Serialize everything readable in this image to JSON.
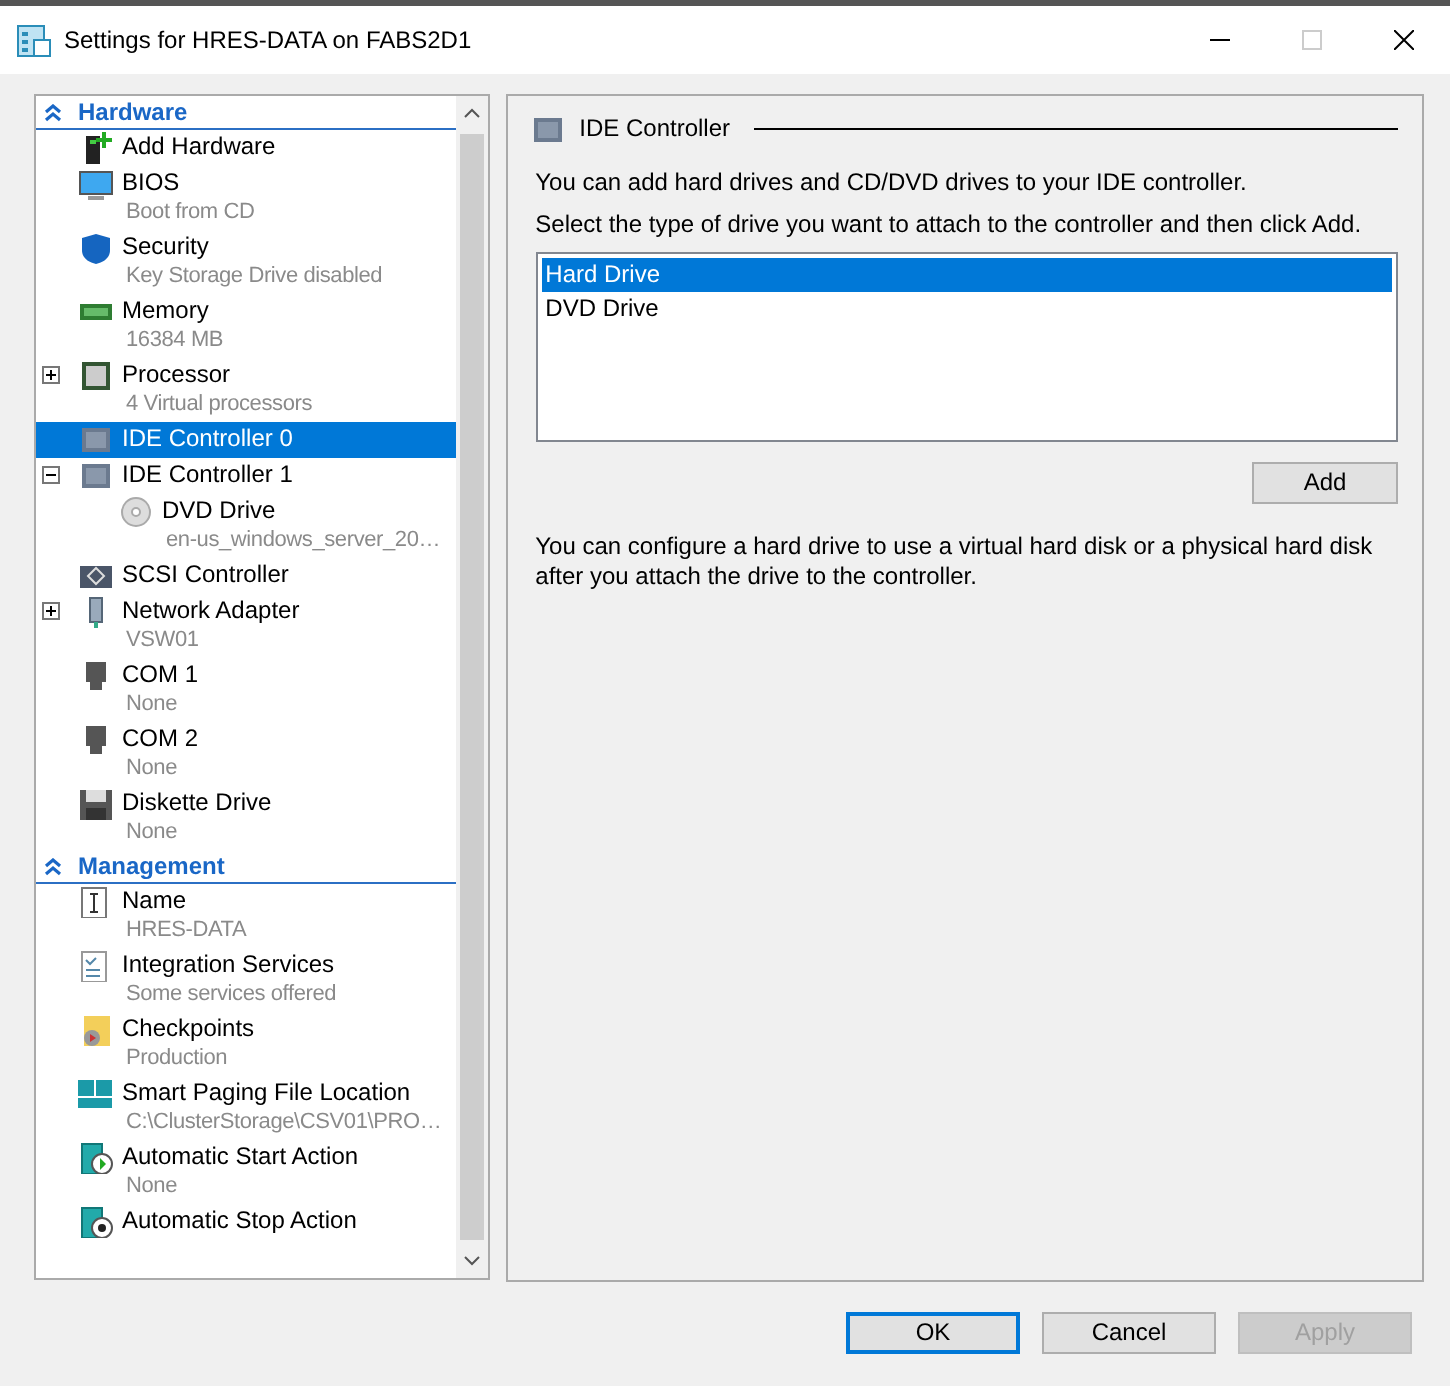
{
  "window": {
    "title": "Settings for HRES-DATA on FABS2D1"
  },
  "sidebar": {
    "sections": [
      {
        "title": "Hardware",
        "expanded": true,
        "items": [
          {
            "label": "Add Hardware",
            "selected": false
          },
          {
            "label": "BIOS",
            "detail": "Boot from CD",
            "selected": false
          },
          {
            "label": "Security",
            "detail": "Key Storage Drive disabled",
            "selected": false
          },
          {
            "label": "Memory",
            "detail": "16384 MB",
            "selected": false
          },
          {
            "label": "Processor",
            "detail": "4 Virtual processors",
            "selected": false,
            "expanded": false
          },
          {
            "label": "IDE Controller 0",
            "selected": true
          },
          {
            "label": "IDE Controller 1",
            "selected": false,
            "expanded": true,
            "children": [
              {
                "label": "DVD Drive",
                "detail": "en-us_windows_server_20…",
                "selected": false
              }
            ]
          },
          {
            "label": "SCSI Controller",
            "selected": false
          },
          {
            "label": "Network Adapter",
            "detail": "VSW01",
            "selected": false,
            "expanded": false
          },
          {
            "label": "COM 1",
            "detail": "None",
            "selected": false
          },
          {
            "label": "COM 2",
            "detail": "None",
            "selected": false
          },
          {
            "label": "Diskette Drive",
            "detail": "None",
            "selected": false
          }
        ]
      },
      {
        "title": "Management",
        "expanded": true,
        "items": [
          {
            "label": "Name",
            "detail": "HRES-DATA",
            "selected": false
          },
          {
            "label": "Integration Services",
            "detail": "Some services offered",
            "selected": false
          },
          {
            "label": "Checkpoints",
            "detail": "Production",
            "selected": false
          },
          {
            "label": "Smart Paging File Location",
            "detail": "C:\\ClusterStorage\\CSV01\\PRO…",
            "selected": false
          },
          {
            "label": "Automatic Start Action",
            "detail": "None",
            "selected": false
          },
          {
            "label": "Automatic Stop Action",
            "selected": false
          }
        ]
      }
    ]
  },
  "panel": {
    "title": "IDE Controller",
    "intro": "You can add hard drives and CD/DVD drives to your IDE controller.",
    "instruction": "Select the type of drive you want to attach to the controller and then click Add.",
    "drive_types": [
      {
        "label": "Hard Drive",
        "selected": true
      },
      {
        "label": "DVD Drive",
        "selected": false
      }
    ],
    "add_button": "Add",
    "note": "You can configure a hard drive to use a virtual hard disk or a physical hard disk after you attach the drive to the controller."
  },
  "buttons": [
    {
      "label": "OK",
      "disabled": false,
      "default": true
    },
    {
      "label": "Cancel",
      "disabled": false,
      "default": false
    },
    {
      "label": "Apply",
      "disabled": true,
      "default": false
    }
  ]
}
